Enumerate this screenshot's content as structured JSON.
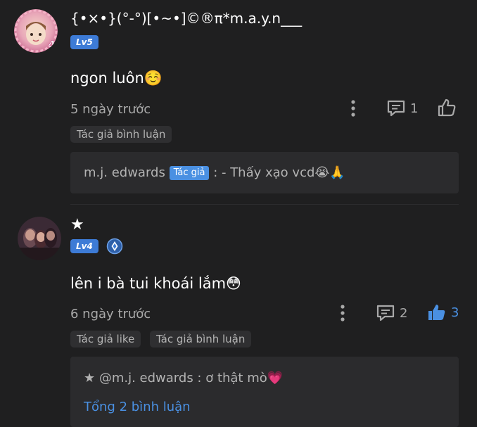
{
  "comments": [
    {
      "username": "{•×•}(°-°)[•~•]©®π*m.a.y.n___",
      "level": "Lv5",
      "text": "ngon luôn☺️",
      "time": "5 ngày trước",
      "reply_count": "1",
      "like_count": "",
      "tags": [
        "Tác giả bình luận"
      ],
      "reply": {
        "author": "m.j. edwards",
        "badge": "Tác giả",
        "text": ": - Thấy xạo vcd😭🙏"
      }
    },
    {
      "username": "★",
      "level": "Lv4",
      "text": "lên i bà tui khoái lắm😳",
      "time": "6 ngày trước",
      "reply_count": "2",
      "like_count": "3",
      "tags": [
        "Tác giả like",
        "Tác giả bình luận"
      ],
      "reply": {
        "text": "★ @m.j. edwards : ơ thật mò💗",
        "more_link": "Tổng 2 bình luận"
      }
    }
  ],
  "colors": {
    "accent": "#4a90e2",
    "level_badge": "#3d7bd6",
    "background": "#1f1f20",
    "muted": "#a9a9a9"
  }
}
